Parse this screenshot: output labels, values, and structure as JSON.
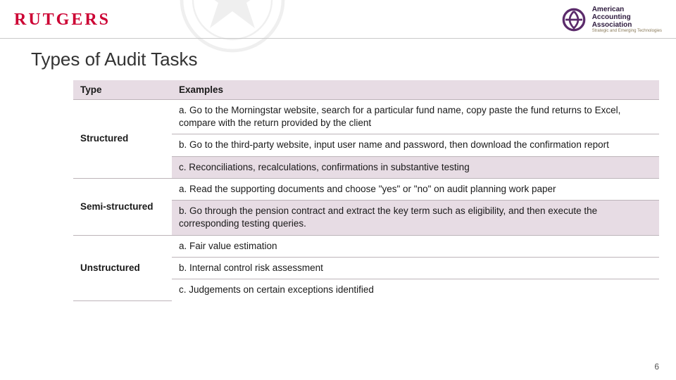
{
  "header": {
    "left_logo_text": "RUTGERS",
    "right_logo_line1": "American",
    "right_logo_line2": "Accounting",
    "right_logo_line3": "Association",
    "right_logo_sub": "Strategic and Emerging Technologies"
  },
  "title": "Types of Audit Tasks",
  "table": {
    "header_type": "Type",
    "header_examples": "Examples",
    "rows": [
      {
        "type": "Structured",
        "examples": [
          "a. Go to the Morningstar website, search for a particular fund name, copy paste the fund returns to Excel, compare with the return provided by the client",
          "b. Go to the third-party website, input user name and password, then download the confirmation report",
          "c. Reconciliations, recalculations, confirmations in substantive testing"
        ]
      },
      {
        "type": "Semi-structured",
        "examples": [
          "a. Read the supporting documents and choose \"yes\" or \"no\" on audit planning work paper",
          "b. Go through the pension contract and extract the key term such as eligibility, and then execute the corresponding testing queries."
        ]
      },
      {
        "type": "Unstructured",
        "examples": [
          "a. Fair value estimation",
          "b. Internal control risk assessment",
          "c. Judgements on certain exceptions identified"
        ]
      }
    ]
  },
  "page_number": "6"
}
